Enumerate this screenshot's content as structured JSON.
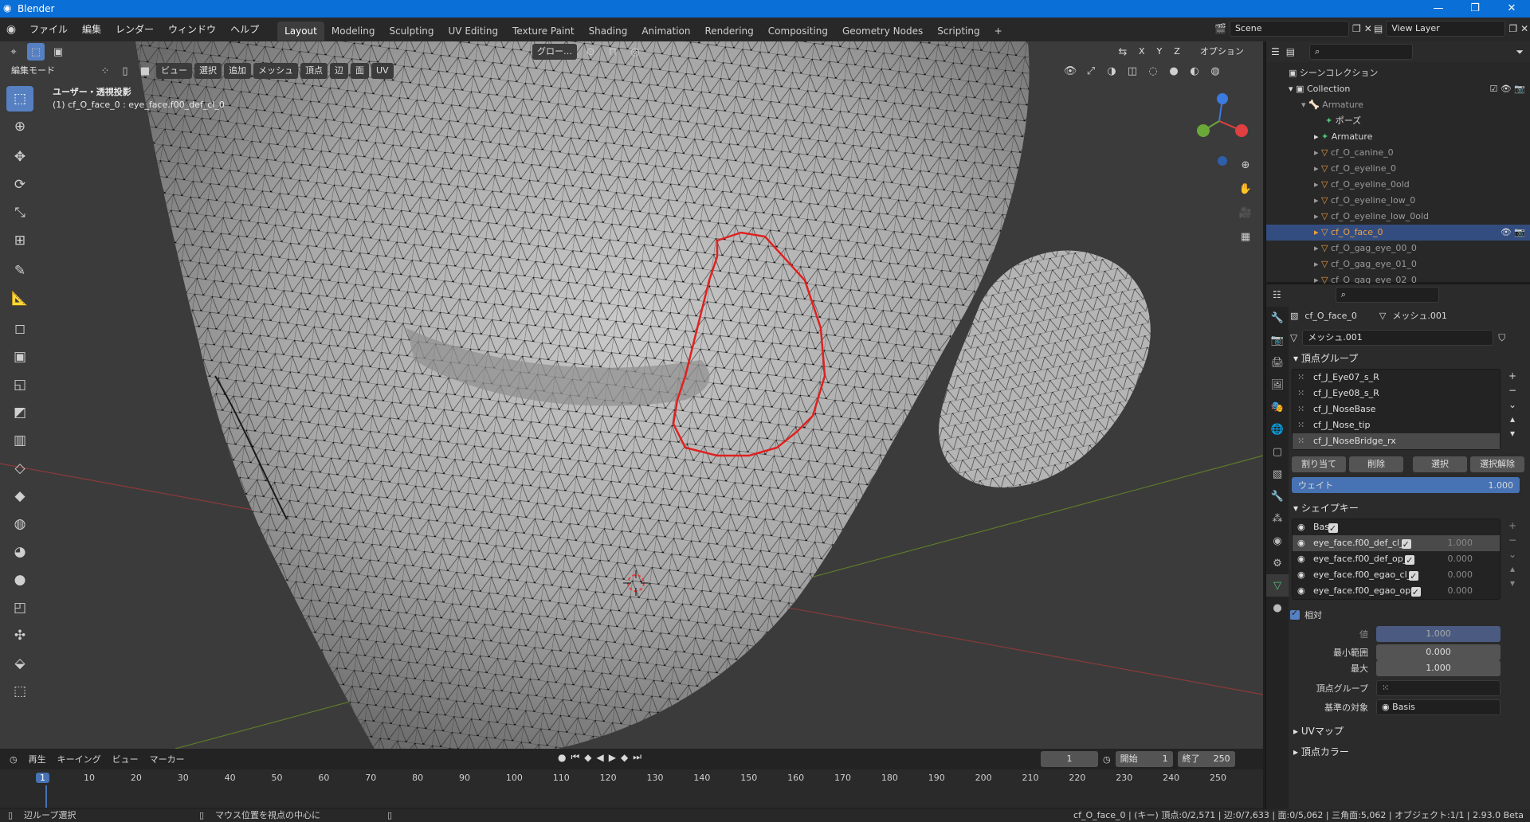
{
  "window": {
    "title": "Blender"
  },
  "menu": {
    "items": [
      "ファイル",
      "編集",
      "レンダー",
      "ウィンドウ",
      "ヘルプ"
    ]
  },
  "workspaces": [
    "Layout",
    "Modeling",
    "Sculpting",
    "UV Editing",
    "Texture Paint",
    "Shading",
    "Animation",
    "Rendering",
    "Compositing",
    "Geometry Nodes",
    "Scripting"
  ],
  "active_workspace": "Layout",
  "scene": {
    "name": "Scene",
    "view_layer": "View Layer"
  },
  "viewport_header": {
    "mode": "編集モード",
    "menus": [
      "ビュー",
      "選択",
      "追加",
      "メッシュ",
      "頂点",
      "辺",
      "面",
      "UV"
    ],
    "transform": "グロー…",
    "options": "オプション",
    "xyz": [
      "X",
      "Y",
      "Z"
    ]
  },
  "viewport": {
    "projection": "ユーザー・透視投影",
    "object_info": "(1) cf_O_face_0 : eye_face.f00_def_cl_0"
  },
  "outliner": {
    "scene_collection": "シーンコレクション",
    "collection": "Collection",
    "armature": "Armature",
    "pose": "ポーズ",
    "armature_data": "Armature",
    "objects": [
      "cf_O_canine_0",
      "cf_O_eyeline_0",
      "cf_O_eyeline_0old",
      "cf_O_eyeline_low_0",
      "cf_O_eyeline_low_0old",
      "cf_O_face_0",
      "cf_O_gag_eye_00_0",
      "cf_O_gag_eye_01_0",
      "cf_O_gag_eye_02_0"
    ],
    "selected": "cf_O_face_0"
  },
  "properties": {
    "breadcrumb_object": "cf_O_face_0",
    "breadcrumb_mesh": "メッシュ.001",
    "mesh_name": "メッシュ.001",
    "vertex_groups_title": "頂点グループ",
    "vertex_groups": [
      "cf_J_Eye07_s_R",
      "cf_J_Eye08_s_R",
      "cf_J_NoseBase",
      "cf_J_Nose_tip",
      "cf_J_NoseBridge_rx"
    ],
    "vg_buttons": [
      "割り当て",
      "削除",
      "選択",
      "選択解除"
    ],
    "weight_label": "ウェイト",
    "weight_value": "1.000",
    "shapekeys_title": "シェイプキー",
    "shapekeys": [
      {
        "name": "Basis",
        "value": ""
      },
      {
        "name": "eye_face.f00_def_cl_0",
        "value": "1.000"
      },
      {
        "name": "eye_face.f00_def_op_0",
        "value": "0.000"
      },
      {
        "name": "eye_face.f00_egao_cl_0",
        "value": "0.000"
      },
      {
        "name": "eye_face.f00_egao_op...",
        "value": "0.000"
      }
    ],
    "relative_label": "相対",
    "value_label": "値",
    "value": "1.000",
    "min_label": "最小範囲",
    "min_value": "0.000",
    "max_label": "最大",
    "max_value": "1.000",
    "vgroup_label": "頂点グループ",
    "relative_to_label": "基準の対象",
    "relative_to": "Basis",
    "uvmap_title": "UVマップ",
    "vertex_color_title": "頂点カラー"
  },
  "timeline": {
    "menus": [
      "再生",
      "キーイング",
      "ビュー",
      "マーカー"
    ],
    "current_frame": "1",
    "start_label": "開始",
    "start": "1",
    "end_label": "終了",
    "end": "250",
    "ticks": [
      "1",
      "10",
      "20",
      "30",
      "40",
      "50",
      "60",
      "70",
      "80",
      "90",
      "100",
      "110",
      "120",
      "130",
      "140",
      "150",
      "160",
      "170",
      "180",
      "190",
      "200",
      "210",
      "220",
      "230",
      "240",
      "250"
    ]
  },
  "status": {
    "left1": "辺ループ選択",
    "left2": "マウス位置を視点の中心に",
    "right": "cf_O_face_0 | (キー) 頂点:0/2,571 | 辺:0/7,633 | 面:0/5,062 | 三角面:5,062 | オブジェクト:1/1 | 2.93.0 Beta"
  },
  "colors": {
    "accent": "#5680c2",
    "selection_outline": "#e02020",
    "titlebar": "#0a6fd6"
  }
}
